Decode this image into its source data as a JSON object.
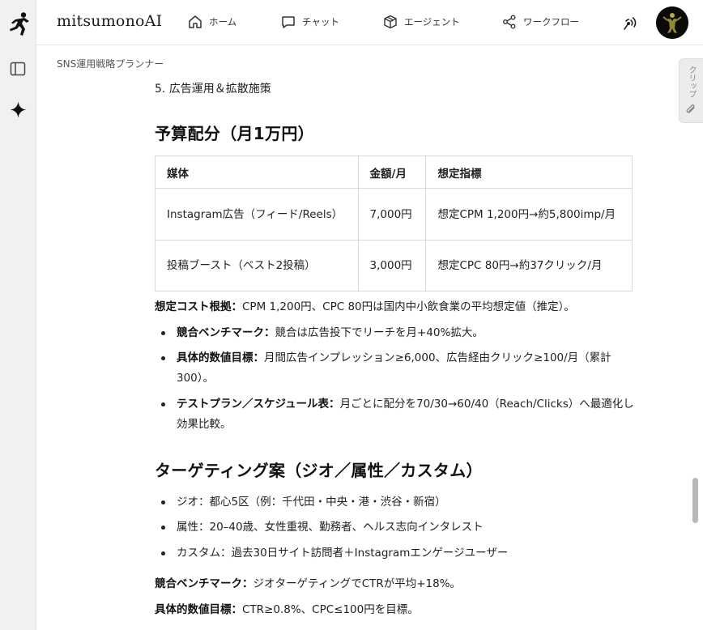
{
  "app": {
    "brand": "mitsumonoAI"
  },
  "nav": [
    {
      "label": "ホーム",
      "icon": "home-icon"
    },
    {
      "label": "チャット",
      "icon": "chat-icon"
    },
    {
      "label": "エージェント",
      "icon": "cube-icon"
    },
    {
      "label": "ワークフロー",
      "icon": "share-icon"
    }
  ],
  "breadcrumb": "SNS運用戦略プランナー",
  "content": {
    "list_item_5": "5. 広告運用＆拡散施策",
    "budget_heading": "予算配分（月1万円）",
    "budget_table": {
      "headers": [
        "媒体",
        "金額/月",
        "想定指標"
      ],
      "rows": [
        {
          "media": "Instagram広告（フィード/Reels）",
          "amount": "7,000円",
          "metric": "想定CPM 1,200円→約5,800imp/月"
        },
        {
          "media": "投稿ブースト（ベスト2投稿）",
          "amount": "3,000円",
          "metric": "想定CPC 80円→約37クリック/月"
        }
      ]
    },
    "cost_basis_label": "想定コスト根拠：",
    "cost_basis_text": "CPM 1,200円、CPC 80円は国内中小飲食業の平均想定値（推定）。",
    "budget_bullets": [
      {
        "label": "競合ベンチマーク：",
        "text": "競合は広告投下でリーチを月+40%拡大。"
      },
      {
        "label": "具体的数値目標：",
        "text": "月間広告インプレッション≥6,000、広告経由クリック≥100/月（累計300）。"
      },
      {
        "label": "テストプラン／スケジュール表：",
        "text": "月ごとに配分を70/30→60/40（Reach/Clicks）へ最適化し効果比較。"
      }
    ],
    "targeting_heading": "ターゲティング案（ジオ／属性／カスタム）",
    "targeting_bullets": [
      "ジオ：都心5区（例：千代田・中央・港・渋谷・新宿）",
      "属性：20–40歳、女性重視、勤務者、ヘルス志向インタレスト",
      "カスタム：過去30日サイト訪問者＋Instagramエンゲージユーザー"
    ],
    "targeting_bench_label": "競合ベンチマーク：",
    "targeting_bench_text": "ジオターゲティングでCTRが平均+18%。",
    "targeting_goal_label": "具体的数値目標：",
    "targeting_goal_text": "CTR≥0.8%、CPC≤100円を目標。"
  },
  "side_tab": {
    "label": "クリップ",
    "icon": "paperclip-icon"
  }
}
